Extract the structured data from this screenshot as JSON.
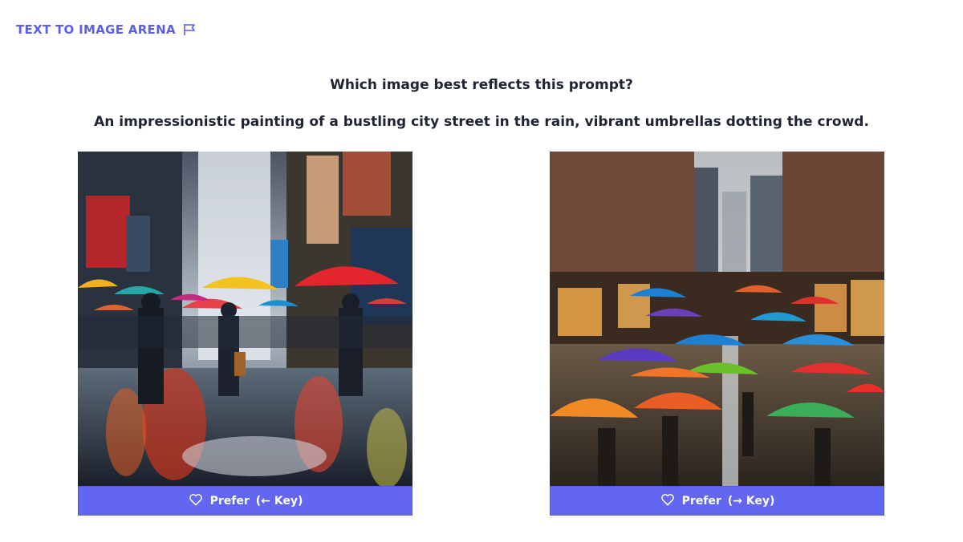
{
  "header": {
    "title": "TEXT TO IMAGE ARENA",
    "flag_icon": "flag-icon"
  },
  "question": "Which image best reflects this prompt?",
  "prompt": "An impressionistic painting of a bustling city street in the rain, vibrant umbrellas dotting the crowd.",
  "options": [
    {
      "button_label": "Prefer",
      "key_hint": "(← Key)",
      "icon": "heart-icon"
    },
    {
      "button_label": "Prefer",
      "key_hint": "(→ Key)",
      "icon": "heart-icon"
    }
  ],
  "colors": {
    "accent": "#6366f1",
    "brand": "#5b5fe8",
    "text": "#1f2433"
  }
}
